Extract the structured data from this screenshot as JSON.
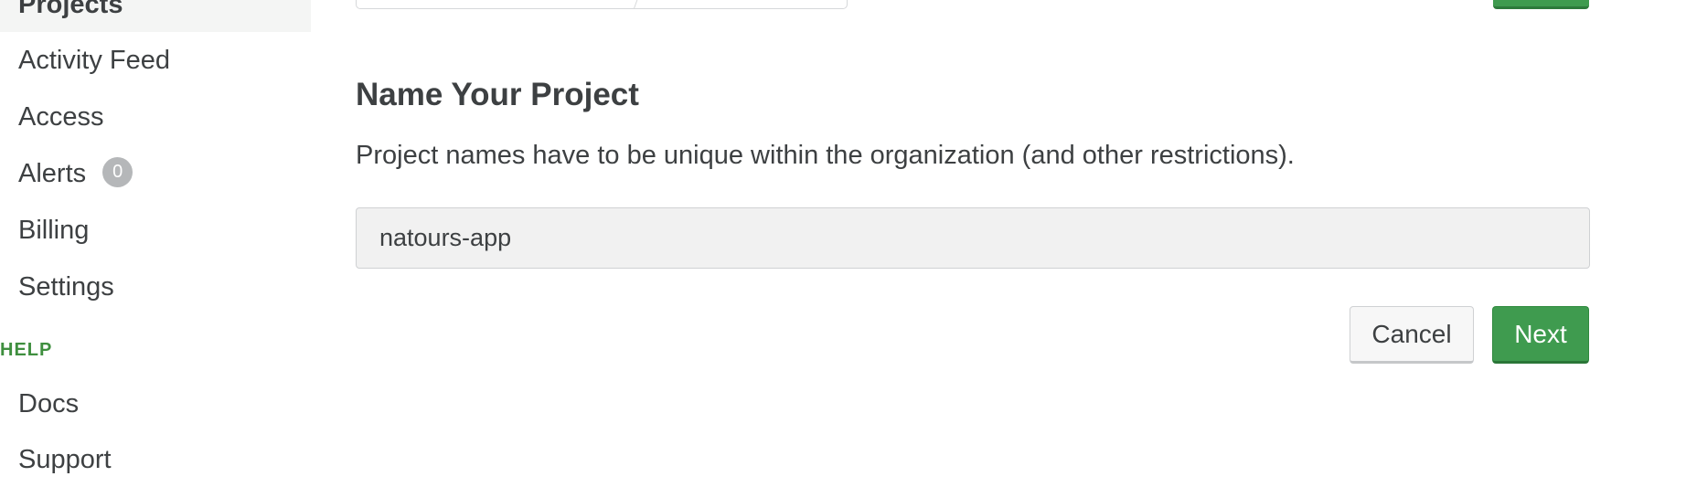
{
  "sidebar": {
    "active_item": "Projects",
    "items": [
      {
        "label": "Activity Feed"
      },
      {
        "label": "Access"
      },
      {
        "label": "Alerts",
        "badge": "0"
      },
      {
        "label": "Billing"
      },
      {
        "label": "Settings"
      }
    ],
    "help_section": {
      "label": "HELP",
      "items": [
        {
          "label": "Docs"
        },
        {
          "label": "Support"
        }
      ]
    }
  },
  "main": {
    "heading": "Name Your Project",
    "description": "Project names have to be unique within the organization (and other restrictions).",
    "project_name_value": "natours-app",
    "cancel_label": "Cancel",
    "next_label": "Next"
  },
  "colors": {
    "accent_green": "#3f9b4f",
    "help_label_green": "#3f8f3f",
    "badge_gray": "#b5b7b9",
    "input_background": "#f1f1f1",
    "text": "#3d4042"
  }
}
